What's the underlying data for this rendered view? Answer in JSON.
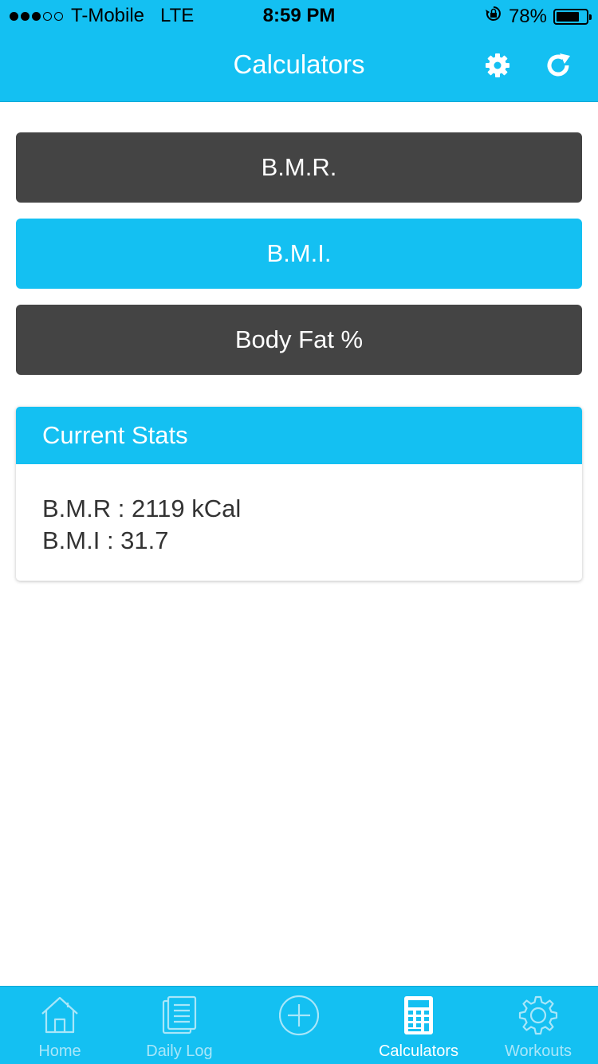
{
  "status_bar": {
    "carrier": "T-Mobile",
    "network": "LTE",
    "time": "8:59 PM",
    "battery": "78%",
    "battery_level": 0.78,
    "signal_bars_filled": 3,
    "signal_bars_total": 5
  },
  "header": {
    "title": "Calculators",
    "icons": [
      "gear-icon",
      "refresh-icon"
    ]
  },
  "calculators": [
    {
      "label": "B.M.R.",
      "style": "dark"
    },
    {
      "label": "B.M.I.",
      "style": "blue"
    },
    {
      "label": "Body Fat %",
      "style": "dark"
    }
  ],
  "current_stats": {
    "title": "Current Stats",
    "lines": [
      "B.M.R : 2119 kCal",
      "B.M.I : 31.7"
    ]
  },
  "tab_bar": {
    "tabs": [
      {
        "label": "Home",
        "icon": "home-icon",
        "active": false
      },
      {
        "label": "Daily Log",
        "icon": "log-icon",
        "active": false
      },
      {
        "label": "",
        "icon": "add-icon",
        "active": false
      },
      {
        "label": "Calculators",
        "icon": "calculator-icon",
        "active": true
      },
      {
        "label": "Workouts",
        "icon": "workouts-gear-icon",
        "active": false
      }
    ]
  },
  "colors": {
    "accent": "#14c0f2",
    "dark_button": "#444444",
    "inactive_tab": "#a8e6f9"
  }
}
